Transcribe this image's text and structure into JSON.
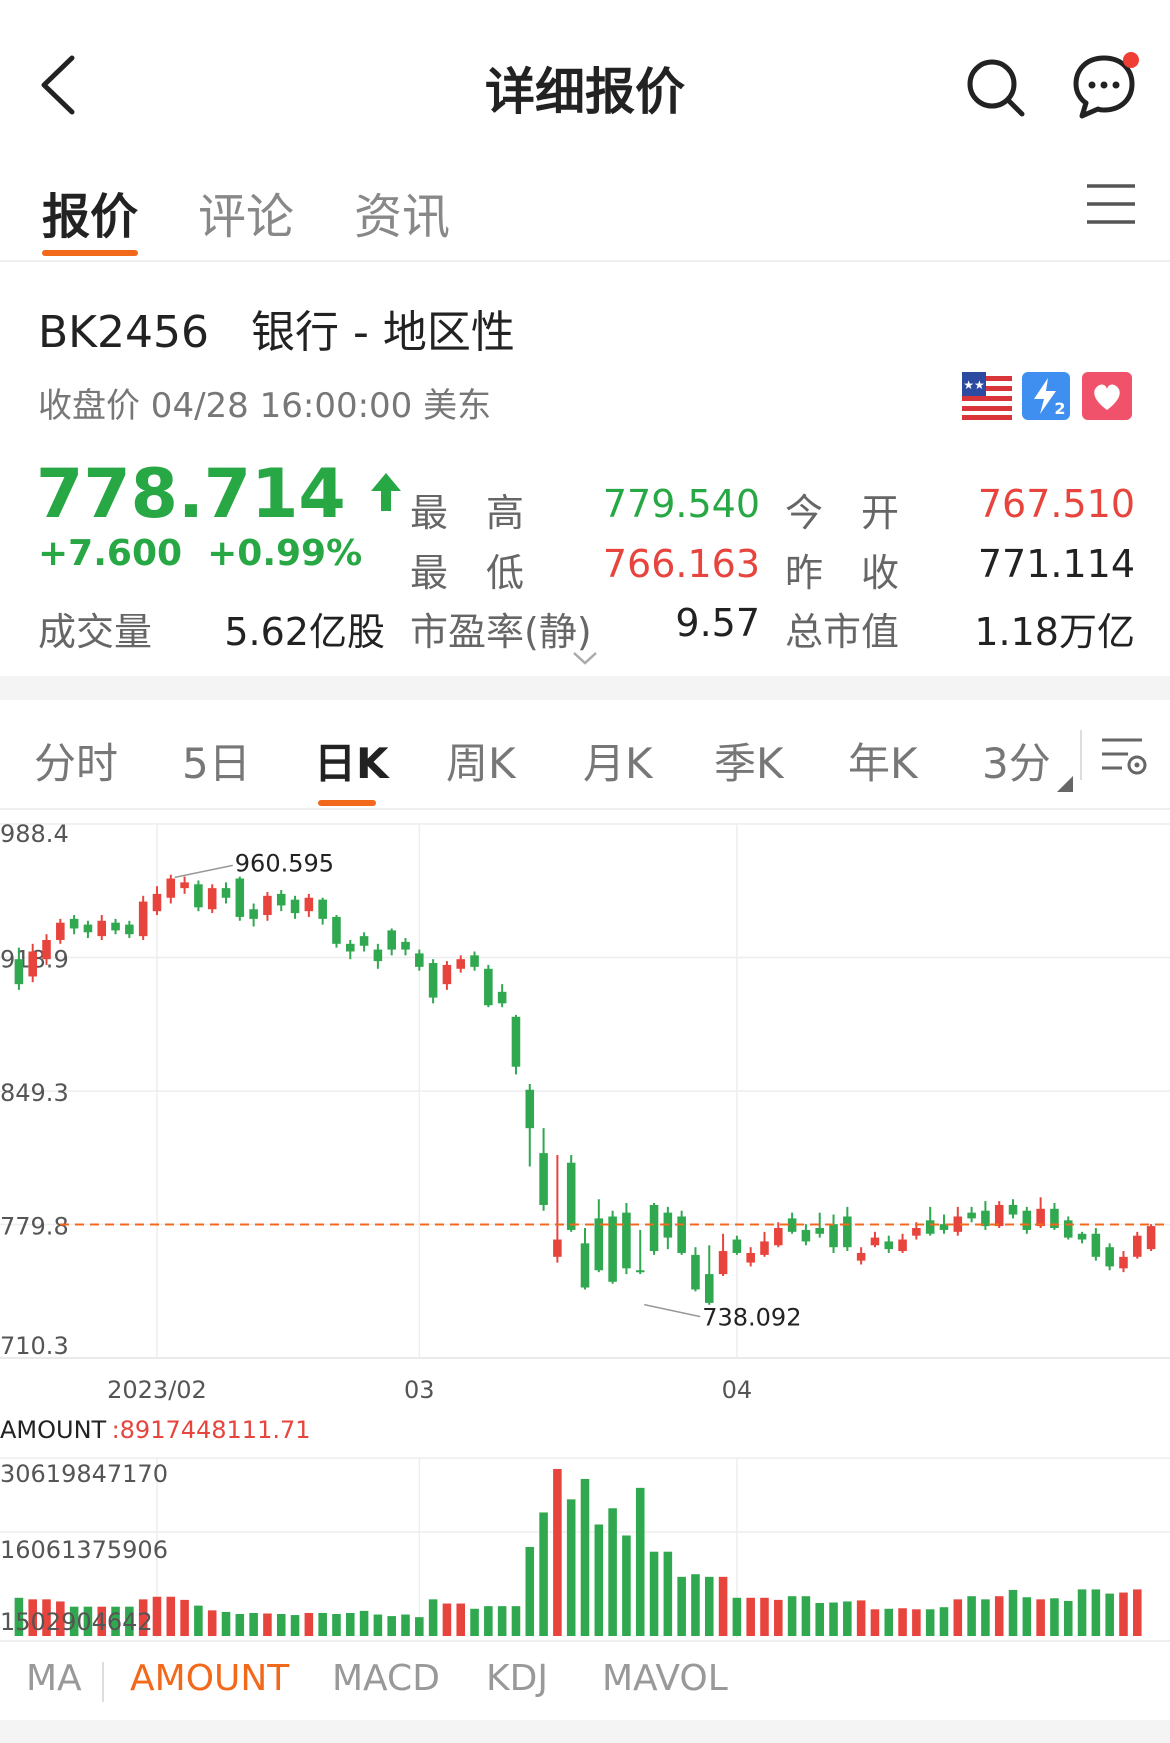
{
  "header": {
    "title": "详细报价"
  },
  "tabs": [
    {
      "label": "报价",
      "active": true
    },
    {
      "label": "评论",
      "active": false
    },
    {
      "label": "资讯",
      "active": false
    }
  ],
  "stock": {
    "code_name": "BK2456   银行 - 地区性",
    "close_time": "收盘价 04/28 16:00:00 美东",
    "price": "778.714",
    "change": "+7.600  +0.99%",
    "volume_label": "成交量",
    "volume_value": "5.62亿股",
    "quotes": [
      {
        "label": "最　高",
        "value": "779.540",
        "color": "#28a745"
      },
      {
        "label": "今　开",
        "value": "767.510",
        "color": "#e8443e"
      },
      {
        "label": "最　低",
        "value": "766.163",
        "color": "#e8443e"
      },
      {
        "label": "昨　收",
        "value": "771.114",
        "color": "#222222"
      },
      {
        "label": "市盈率(静)",
        "value": "9.57",
        "color": "#222222"
      },
      {
        "label": "总市值",
        "value": "1.18万亿",
        "color": "#222222"
      }
    ]
  },
  "period_tabs": [
    {
      "label": "分时",
      "active": false
    },
    {
      "label": "5日",
      "active": false
    },
    {
      "label": "日K",
      "active": true
    },
    {
      "label": "周K",
      "active": false
    },
    {
      "label": "月K",
      "active": false
    },
    {
      "label": "季K",
      "active": false
    },
    {
      "label": "年K",
      "active": false
    },
    {
      "label": "3分",
      "active": false
    }
  ],
  "colors": {
    "up": "#e8443e",
    "down": "#2fa84f",
    "accent": "#f2691c"
  },
  "chart_data": [
    {
      "type": "candlestick",
      "y_ticks": [
        "988.4",
        "918.9",
        "849.3",
        "779.8",
        "710.3"
      ],
      "ylim": [
        710.3,
        988.4
      ],
      "x_ticks": [
        {
          "label": "2023/02",
          "index": 10
        },
        {
          "label": "03",
          "index": 29
        },
        {
          "label": "04",
          "index": 52
        }
      ],
      "reference_line": 779.8,
      "max_label": {
        "value": "960.595",
        "index": 11
      },
      "min_label": {
        "value": "738.092",
        "index": 45
      },
      "candles": [
        [
          918,
          905,
          924,
          902
        ],
        [
          909,
          922,
          926,
          906
        ],
        [
          918,
          928,
          931,
          915
        ],
        [
          928,
          937,
          939,
          926
        ],
        [
          939,
          934,
          941,
          931
        ],
        [
          936,
          932,
          938,
          929
        ],
        [
          930,
          938,
          941,
          928
        ],
        [
          937,
          933,
          939,
          931
        ],
        [
          936,
          931,
          938,
          929
        ],
        [
          930,
          948,
          951,
          928
        ],
        [
          943,
          952,
          956,
          941
        ],
        [
          950,
          960,
          962,
          947
        ],
        [
          955,
          958,
          961,
          952
        ],
        [
          957,
          945,
          959,
          943
        ],
        [
          944,
          955,
          957,
          942
        ],
        [
          955,
          950,
          958,
          947
        ],
        [
          960,
          940,
          961,
          938
        ],
        [
          944,
          939,
          947,
          935
        ],
        [
          941,
          951,
          953,
          938
        ],
        [
          952,
          946,
          954,
          943
        ],
        [
          949,
          942,
          951,
          939
        ],
        [
          943,
          950,
          952,
          940
        ],
        [
          949,
          939,
          950,
          936
        ],
        [
          940,
          926,
          941,
          924
        ],
        [
          926,
          922,
          928,
          918
        ],
        [
          930,
          925,
          932,
          922
        ],
        [
          923,
          917,
          926,
          913
        ],
        [
          933,
          923,
          934,
          920
        ],
        [
          927,
          923,
          929,
          920
        ],
        [
          921,
          914,
          923,
          912
        ],
        [
          916,
          898,
          918,
          895
        ],
        [
          905,
          915,
          917,
          902
        ],
        [
          913,
          918,
          920,
          911
        ],
        [
          920,
          914,
          922,
          912
        ],
        [
          913,
          894,
          915,
          893
        ],
        [
          901,
          895,
          905,
          893
        ],
        [
          888,
          862,
          889,
          858
        ],
        [
          850,
          830,
          853,
          810
        ],
        [
          817,
          790,
          830,
          787
        ],
        [
          763,
          772,
          816,
          760
        ],
        [
          812,
          777,
          816,
          776
        ],
        [
          770,
          747,
          778,
          746
        ],
        [
          783,
          756,
          793,
          755
        ],
        [
          784,
          750,
          787,
          749
        ],
        [
          786,
          757,
          791,
          754
        ],
        [
          756,
          755,
          777,
          754
        ],
        [
          790,
          766,
          791,
          764
        ],
        [
          786,
          773,
          789,
          767
        ],
        [
          784,
          765,
          787,
          764
        ],
        [
          764,
          746,
          768,
          745
        ],
        [
          754,
          739,
          769,
          738
        ],
        [
          754,
          766,
          775,
          753
        ],
        [
          772,
          765,
          774,
          764
        ],
        [
          760,
          765,
          768,
          758
        ],
        [
          764,
          771,
          776,
          763
        ],
        [
          769,
          778,
          781,
          768
        ],
        [
          783,
          776,
          786,
          775
        ],
        [
          777,
          771,
          780,
          769
        ],
        [
          778,
          775,
          786,
          773
        ],
        [
          780,
          768,
          785,
          765
        ],
        [
          784,
          768,
          789,
          766
        ],
        [
          761,
          765,
          768,
          759
        ],
        [
          769,
          773,
          776,
          768
        ],
        [
          771,
          767,
          774,
          765
        ],
        [
          766,
          772,
          775,
          765
        ],
        [
          774,
          778,
          781,
          772
        ],
        [
          782,
          775,
          789,
          774
        ],
        [
          780,
          777,
          785,
          775
        ],
        [
          776,
          784,
          789,
          774
        ],
        [
          786,
          783,
          789,
          781
        ],
        [
          787,
          779,
          792,
          777
        ],
        [
          779,
          790,
          792,
          778
        ],
        [
          790,
          785,
          793,
          783
        ],
        [
          787,
          777,
          789,
          775
        ],
        [
          779,
          788,
          794,
          778
        ],
        [
          788,
          778,
          791,
          777
        ],
        [
          782,
          773,
          784,
          772
        ],
        [
          775,
          772,
          776,
          770
        ],
        [
          775,
          763,
          778,
          761
        ],
        [
          768,
          758,
          770,
          756
        ],
        [
          757,
          763,
          766,
          755
        ],
        [
          763,
          774,
          776,
          762
        ],
        [
          767,
          779,
          780,
          766
        ]
      ]
    },
    {
      "type": "bar",
      "name": "AMOUNT",
      "current_value": ":8917448111.71",
      "y_ticks": [
        "30619847170",
        "16061375906",
        "1502904642"
      ],
      "ylim": [
        0,
        34000000000
      ],
      "values": [
        7300000000.0,
        7000000000.0,
        7000000000.0,
        6600000000.0,
        5600000000.0,
        5600000000.0,
        5600000000.0,
        5600000000.0,
        5600000000.0,
        7000000000.0,
        7500000000.0,
        7500000000.0,
        6900000000.0,
        5800000000.0,
        4900000000.0,
        4600000000.0,
        4200000000.0,
        4400000000.0,
        4300000000.0,
        4200000000.0,
        4000000000.0,
        4400000000.0,
        4400000000.0,
        4200000000.0,
        4400000000.0,
        4800000000.0,
        4100000000.0,
        3800000000.0,
        4100000000.0,
        3600000000.0,
        7000000000.0,
        6200000000.0,
        6200000000.0,
        5200000000.0,
        5700000000.0,
        5700000000.0,
        5700000000.0,
        17000000000.0,
        23600000000.0,
        31900000000.0,
        26100000000.0,
        30000000000.0,
        21300000000.0,
        24400000000.0,
        19200000000.0,
        28300000000.0,
        16100000000.0,
        16100000000.0,
        11300000000.0,
        11800000000.0,
        11300000000.0,
        11300000000.0,
        7300000000.0,
        7300000000.0,
        7300000000.0,
        6900000000.0,
        7600000000.0,
        7600000000.0,
        6300000000.0,
        6400000000.0,
        6600000000.0,
        6800000000.0,
        5100000000.0,
        5200000000.0,
        5300000000.0,
        5100000000.0,
        5100000000.0,
        5500000000.0,
        7000000000.0,
        7600000000.0,
        7000000000.0,
        7600000000.0,
        8800000000.0,
        7400000000.0,
        7000000000.0,
        7200000000.0,
        6700000000.0,
        8900000000.0,
        8900000000.0,
        8100000000.0,
        8300000000.0,
        8900000000.0
      ]
    }
  ],
  "bottom_tabs": [
    {
      "label": "MA",
      "active": false
    },
    {
      "label": "AMOUNT",
      "active": true
    },
    {
      "label": "MACD",
      "active": false
    },
    {
      "label": "KDJ",
      "active": false
    },
    {
      "label": "MAVOL",
      "active": false
    }
  ]
}
